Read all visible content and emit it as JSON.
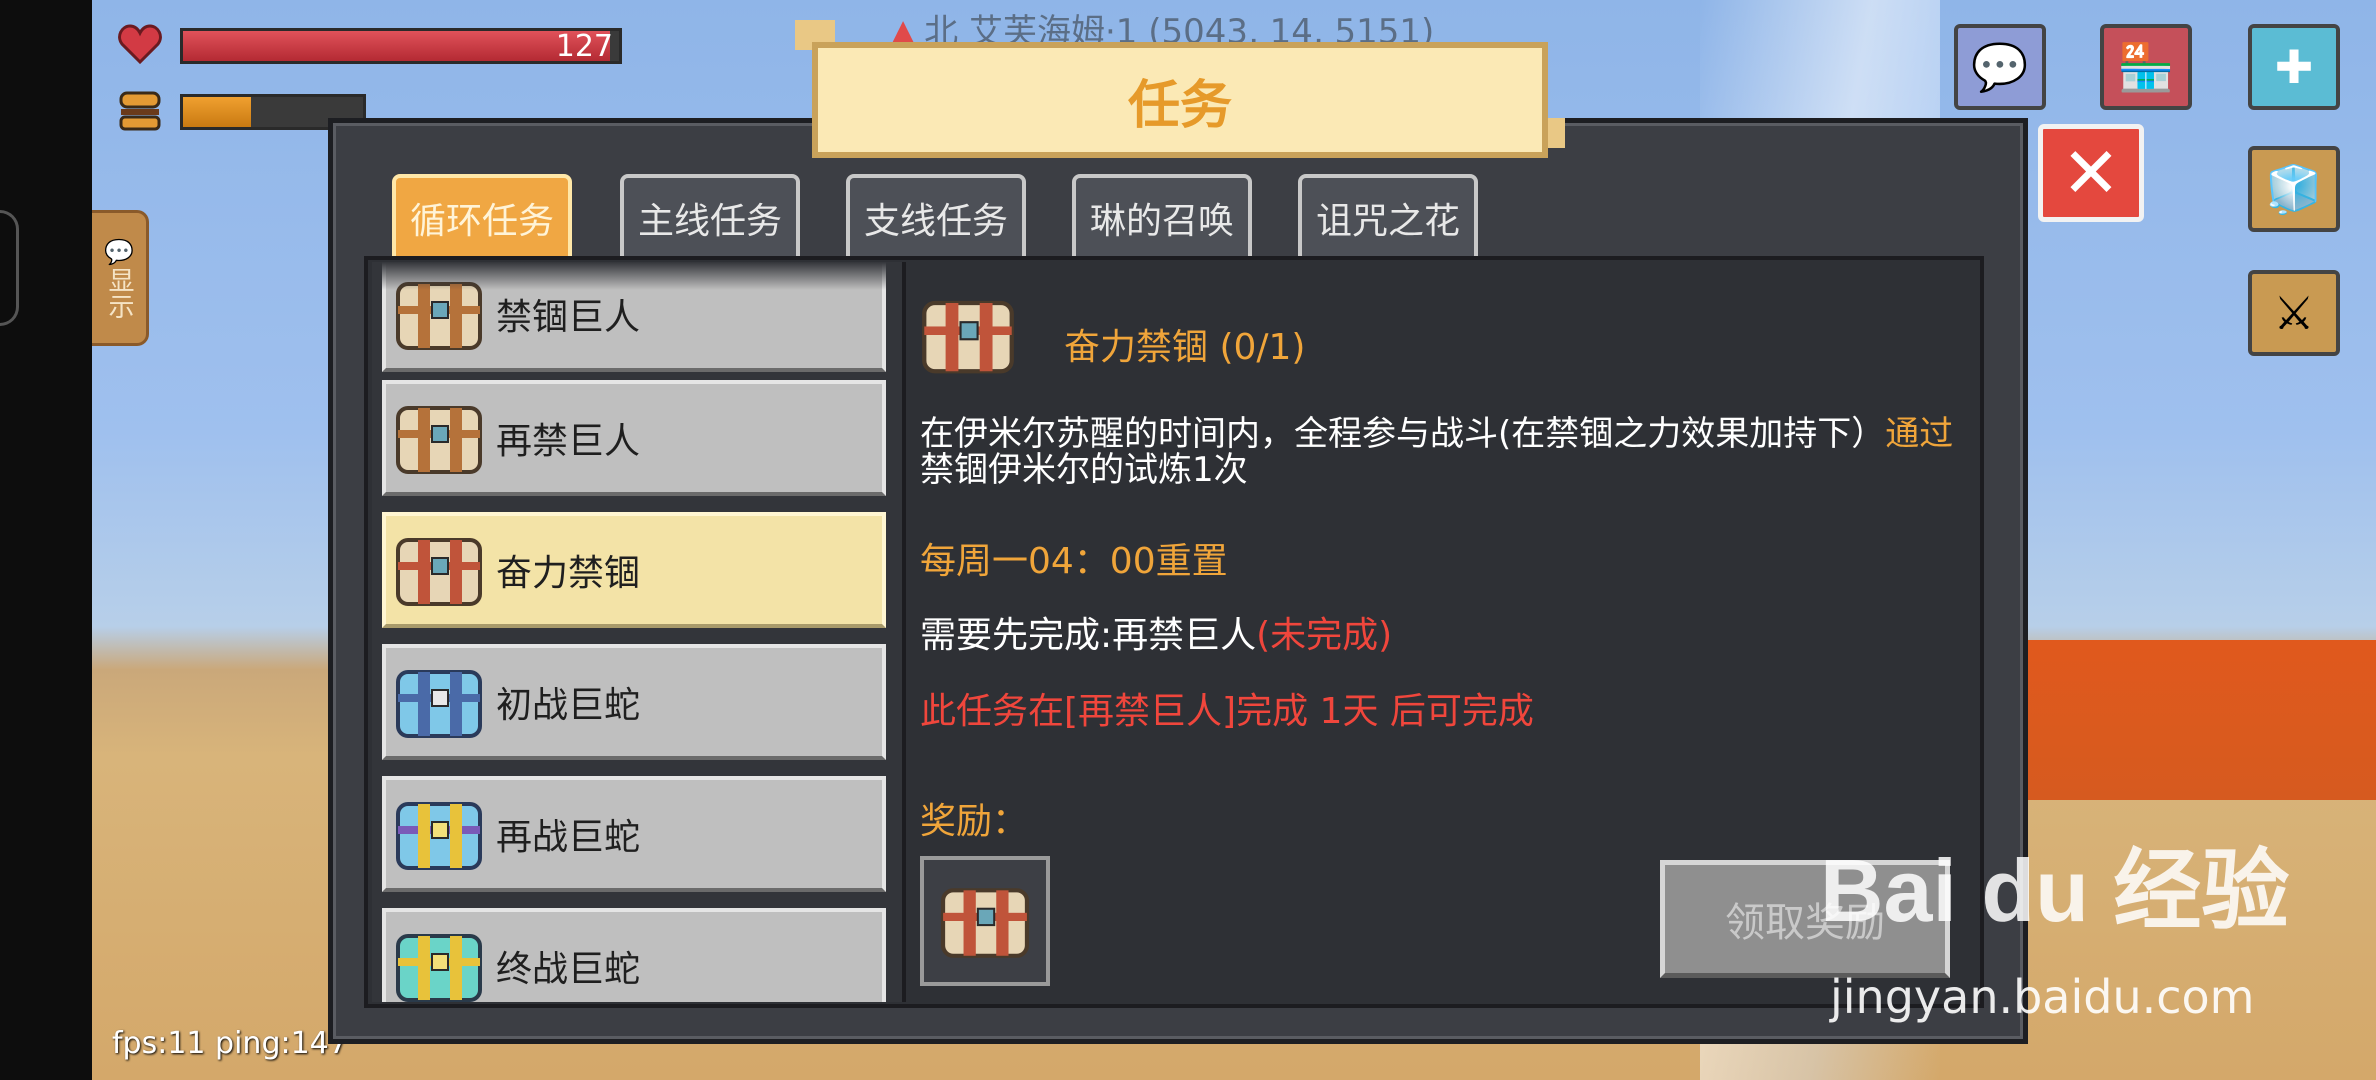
{
  "hud": {
    "health_value": "127",
    "health_fraction": 0.98,
    "hunger_fraction": 0.38,
    "coord_text": "北  艾芙海姆·1 (5043, 14, 5151)",
    "show_label": "显示",
    "fps_text": "fps:11 ping:147"
  },
  "panel": {
    "title": "任务",
    "tabs": [
      "循环任务",
      "主线任务",
      "支线任务",
      "琳的召唤",
      "诅咒之花"
    ],
    "active_tab": 0
  },
  "quests": [
    {
      "name": "禁锢巨人",
      "icon": "chest-bronze-icon"
    },
    {
      "name": "再禁巨人",
      "icon": "chest-bronze-icon"
    },
    {
      "name": "奋力禁锢",
      "icon": "chest-bronze-icon",
      "selected": true
    },
    {
      "name": "初战巨蛇",
      "icon": "chest-blue-icon"
    },
    {
      "name": "再战巨蛇",
      "icon": "chest-blue-gold-icon"
    },
    {
      "name": "终战巨蛇",
      "icon": "chest-teal-gold-icon"
    }
  ],
  "detail": {
    "title": "奋力禁锢 (0/1)",
    "desc_part1": "在伊米尔苏醒的时间内，全程参与战斗(在禁锢之力效果加持下）",
    "desc_highlight": "通过",
    "desc_part2": "禁锢伊米尔的试炼1次",
    "reset": "每周一04：00重置",
    "prereq_label": "需要先完成:再禁巨人",
    "prereq_status": "(未完成)",
    "warning": "此任务在[再禁巨人]完成 1天 后可完成",
    "reward_label": "奖励：",
    "claim_button": "领取奖励"
  },
  "watermark": {
    "main": "Bai du 经验",
    "sub": "jingyan.baidu.com"
  },
  "colors": {
    "accent_orange": "#f0a53a",
    "warning_red": "#f0463c",
    "close_red": "#e4483e",
    "health_red": "#c9343e",
    "hunger_orange": "#d98a1a"
  }
}
